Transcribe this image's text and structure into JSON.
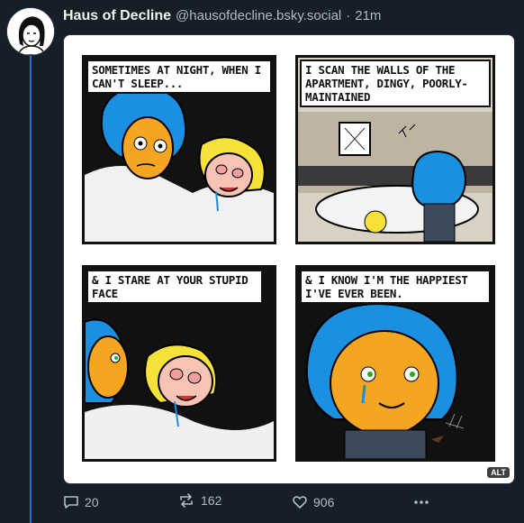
{
  "post": {
    "author_display_name": "Haus of Decline",
    "author_handle": "@hausofdecline.bsky.social",
    "separator": "·",
    "time_ago": "21m"
  },
  "media": {
    "alt_badge": "ALT",
    "panels": [
      {
        "caption": "Sometimes at night, when I can't sleep..."
      },
      {
        "caption": "I scan the walls of the apartment, dingy, poorly-maintained"
      },
      {
        "caption": "& I stare at your stupid face"
      },
      {
        "caption": "& I know I'm the happiest I've ever been."
      }
    ]
  },
  "actions": {
    "reply_count": "20",
    "repost_count": "162",
    "like_count": "906"
  },
  "colors": {
    "background": "#161e27",
    "thread_line": "#2e6bd6",
    "muted_text": "#aebbc9",
    "hair_blue": "#1b8fe0",
    "skin_orange": "#f4a521",
    "hair_blonde": "#f7e23a"
  },
  "icons": [
    "reply-icon",
    "repost-icon",
    "like-icon",
    "more-icon"
  ]
}
